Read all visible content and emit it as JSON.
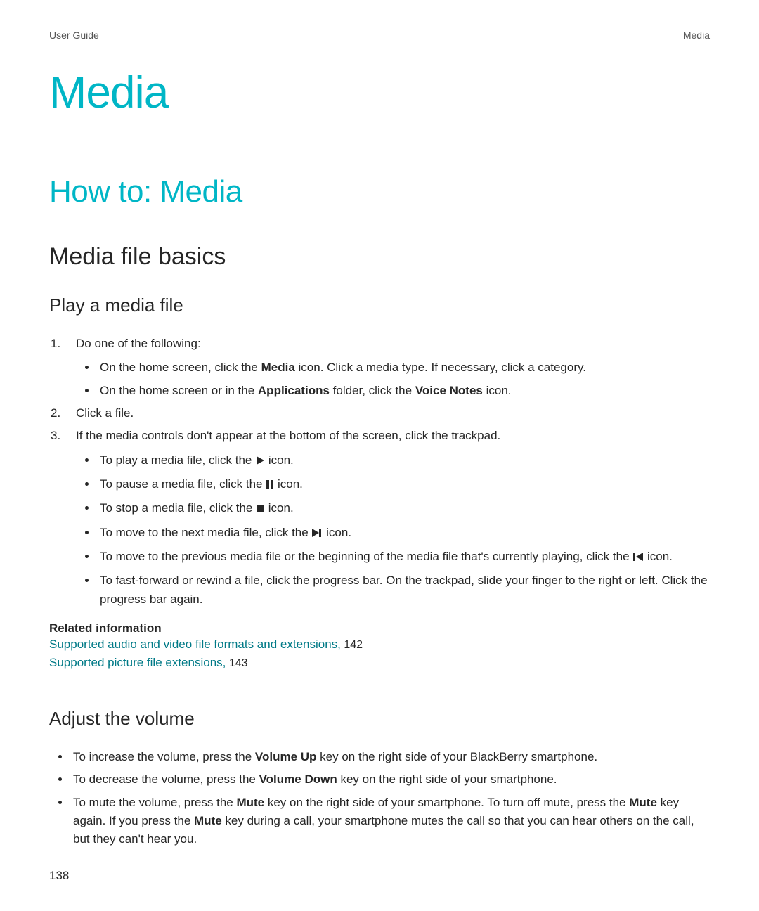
{
  "header": {
    "left": "User Guide",
    "right": "Media"
  },
  "title": "Media",
  "howto": "How to: Media",
  "basics": "Media file basics",
  "play": {
    "heading": "Play a media file",
    "step1": "Do one of the following:",
    "bullet1a_pre": "On the home screen, click the ",
    "bullet1a_bold": "Media",
    "bullet1a_post": " icon. Click a media type. If necessary, click a category.",
    "bullet1b_pre": "On the home screen or in the ",
    "bullet1b_bold1": "Applications",
    "bullet1b_mid": " folder, click the ",
    "bullet1b_bold2": "Voice Notes",
    "bullet1b_post": " icon.",
    "step2": "Click a file.",
    "step3": "If the media controls don't appear at the bottom of the screen, click the trackpad.",
    "act_play_pre": "To play a media file, click the ",
    "act_pause_pre": "To pause a media file, click the ",
    "act_stop_pre": "To stop a media file, click the ",
    "act_next_pre": "To move to the next media file, click the ",
    "act_prev_pre": "To move to the previous media file or the beginning of the media file that's currently playing, click the ",
    "icon_word": " icon.",
    "act_ff": "To fast-forward or rewind a file, click the progress bar. On the trackpad, slide your finger to the right or left. Click the progress bar again."
  },
  "related": {
    "heading": "Related information",
    "link1_text": "Supported audio and video file formats and extensions,",
    "link1_page": " 142",
    "link2_text": "Supported picture file extensions,",
    "link2_page": " 143"
  },
  "volume": {
    "heading": "Adjust the volume",
    "b1_pre": "To increase the volume, press the ",
    "b1_bold": "Volume Up",
    "b1_post": " key on the right side of your BlackBerry smartphone.",
    "b2_pre": "To decrease the volume, press the ",
    "b2_bold": "Volume Down",
    "b2_post": " key on the right side of your smartphone.",
    "b3_pre": "To mute the volume, press the ",
    "b3_bold1": "Mute",
    "b3_mid1": " key on the right side of your smartphone. To turn off mute, press the ",
    "b3_bold2": "Mute",
    "b3_mid2": " key again. If you press the ",
    "b3_bold3": "Mute",
    "b3_post": " key during a call, your smartphone mutes the call so that you can hear others on the call, but they can't hear you."
  },
  "page_number": "138"
}
